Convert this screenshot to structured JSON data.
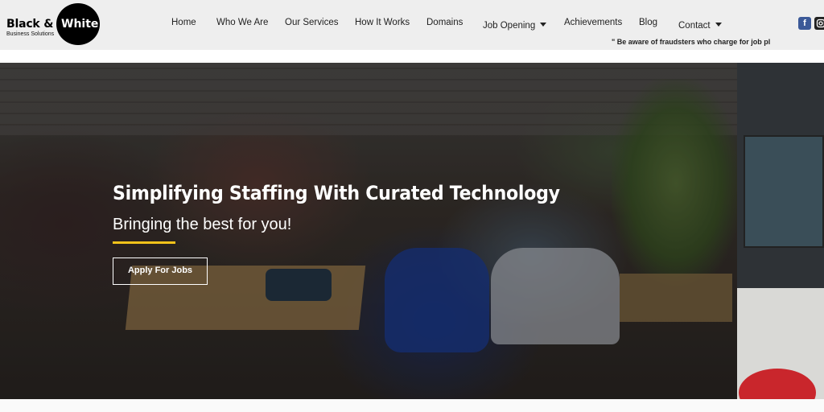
{
  "header": {
    "logo": {
      "brand_black": "Black &",
      "brand_white": "White",
      "tagline": "Business Solutions"
    },
    "nav": [
      {
        "label": "Home"
      },
      {
        "label": "Who We Are"
      },
      {
        "label": "Our Services"
      },
      {
        "label": "How It Works"
      },
      {
        "label": "Domains"
      },
      {
        "label": "Job Opening",
        "dropdown": true
      },
      {
        "label": "Achievements"
      },
      {
        "label": "Blog"
      },
      {
        "label": "Contact",
        "dropdown": true
      }
    ],
    "social": [
      {
        "icon": "facebook-icon",
        "glyph": "f",
        "color": "#3b5998"
      },
      {
        "icon": "instagram-icon",
        "color": "#222222"
      }
    ],
    "ticker": "\" Be aware of fraudsters who charge for job pl"
  },
  "hero": {
    "title": "Simplifying Staffing With Curated Technology",
    "subtitle": "Bringing the best for you!",
    "cta_label": "Apply For Jobs",
    "accent_color": "#f2c21a"
  }
}
